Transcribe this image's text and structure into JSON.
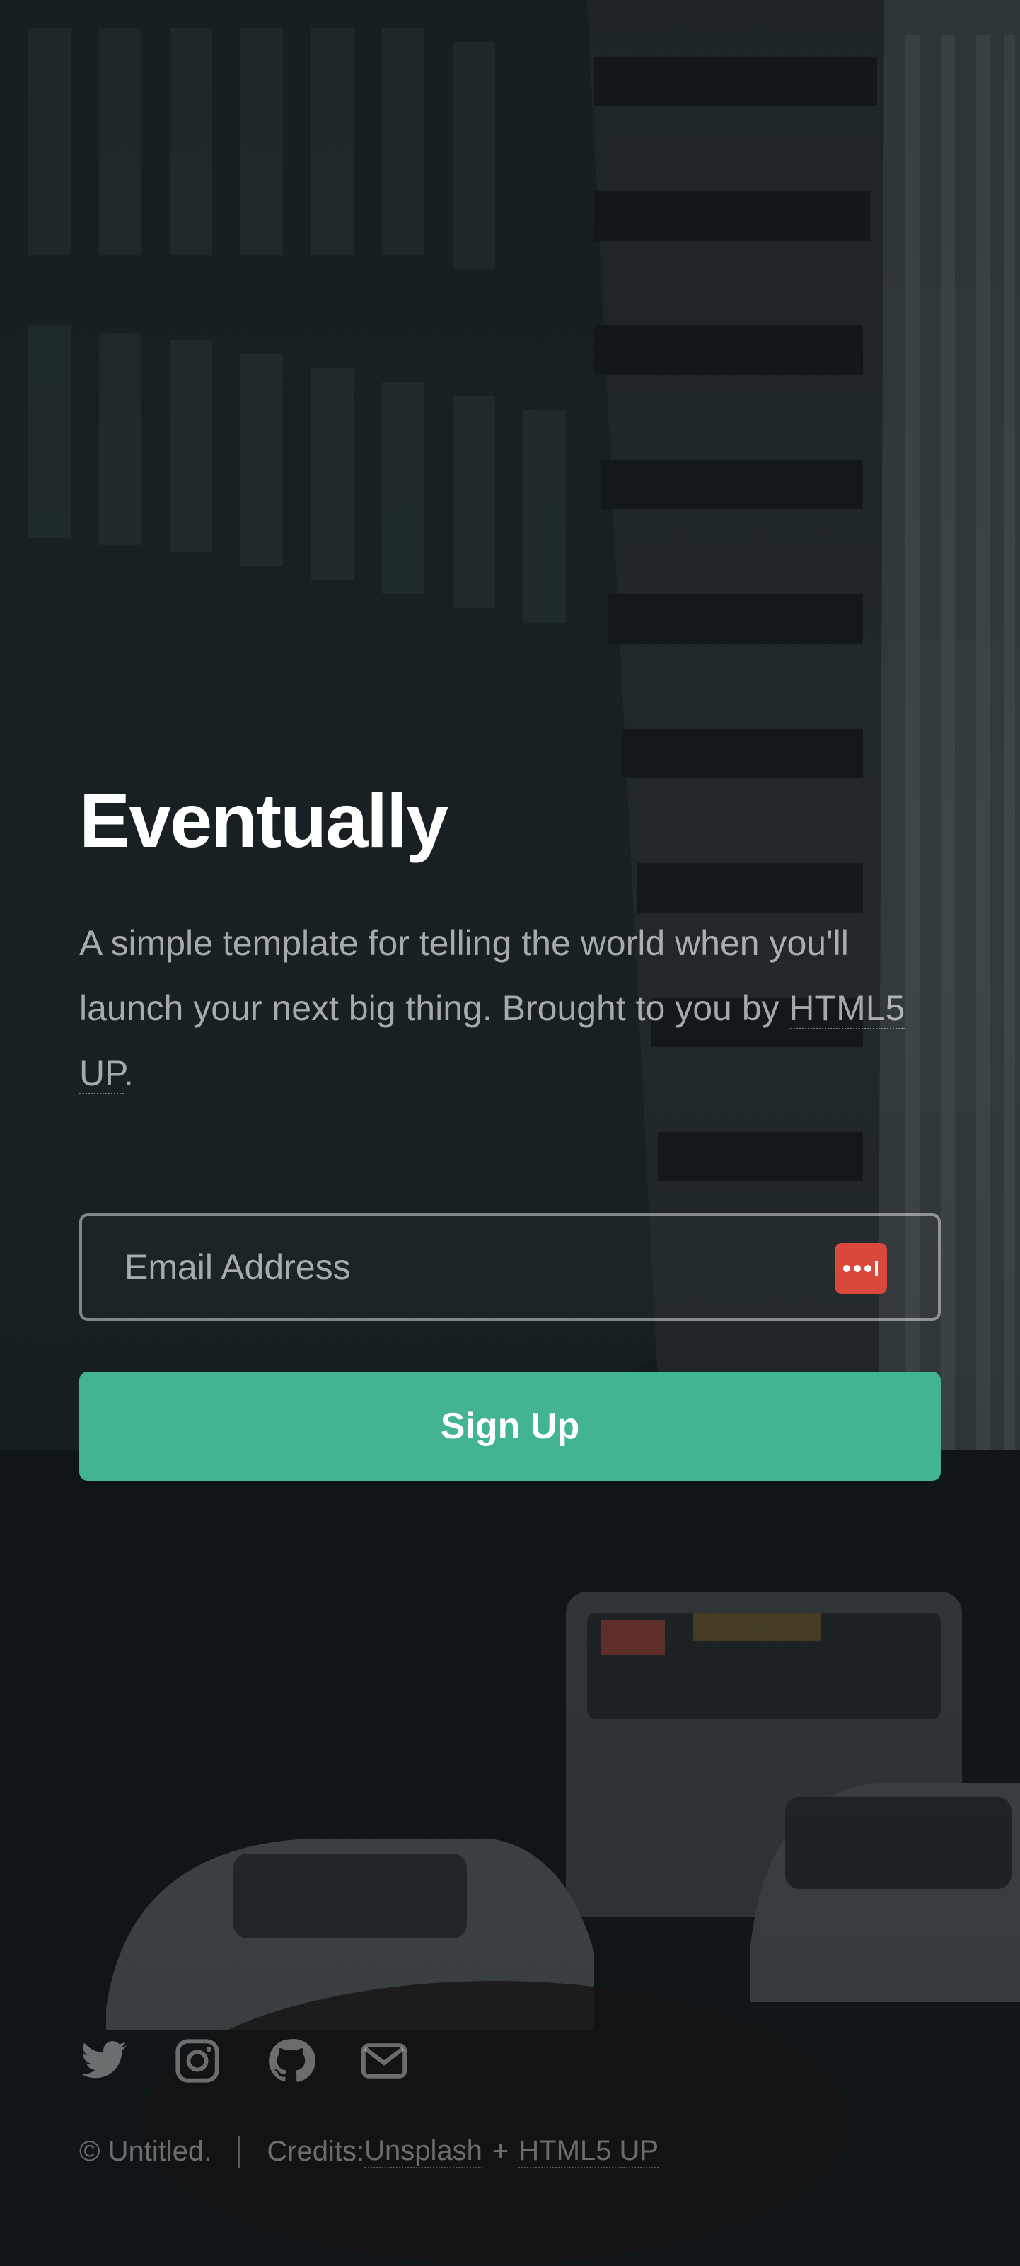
{
  "header": {
    "title": "Eventually",
    "lead_text": "A simple template for telling the world when you'll launch your next big thing. Brought to you by ",
    "lead_link": "HTML5 UP",
    "lead_end": "."
  },
  "signup_form": {
    "email_placeholder": "Email Address",
    "password_manager_icon": "password-manager-icon",
    "submit_label": "Sign Up"
  },
  "footer": {
    "social_icons": [
      "twitter-icon",
      "instagram-icon",
      "github-icon",
      "email-icon"
    ],
    "copyright": "© Untitled.",
    "credits_label": "Credits: ",
    "credits_link_1": "Unsplash",
    "credits_plus": "+",
    "credits_link_2": "HTML5 UP"
  },
  "colors": {
    "accent": "#43b493",
    "password_icon_bg": "#d9483b",
    "background": "#1b2226"
  }
}
